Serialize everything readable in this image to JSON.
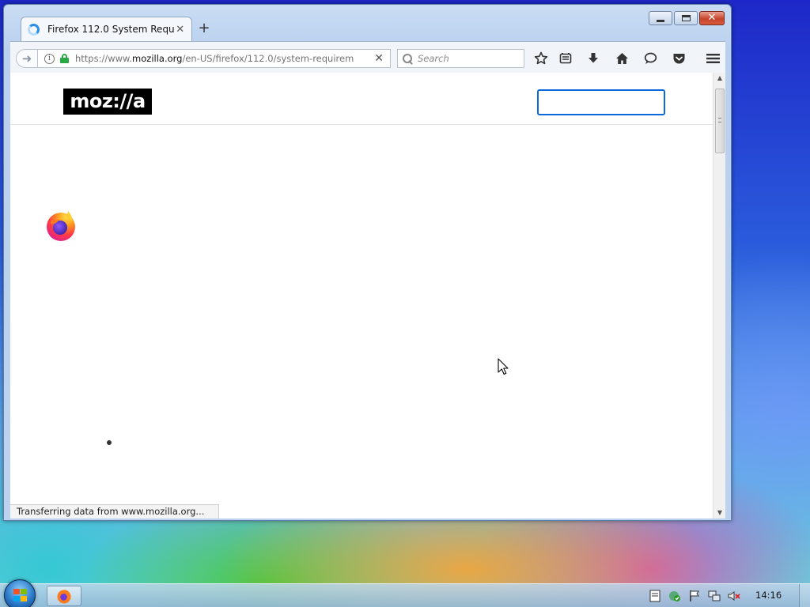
{
  "browser": {
    "tab": {
      "title": "Firefox 112.0 System Requir..."
    },
    "url": {
      "prefix": "https://www.",
      "host": "mozilla.org",
      "path": "/en-US/firefox/112.0/system-requirem"
    },
    "search": {
      "placeholder": "Search"
    },
    "status_text": "Transferring data from www.mozilla.org..."
  },
  "page": {
    "logo_text": "moz://a",
    "search_value": ""
  },
  "taskbar": {
    "clock": "14:16"
  },
  "colors": {
    "logo_bg": "#000000",
    "header_search_border": "#0a68d8",
    "secure_lock": "#2aa845",
    "close_button": "#c7432b"
  },
  "icons": {
    "tab": "loading-spinner-icon",
    "toolbar": [
      "bookmark-star-icon",
      "reading-list-icon",
      "downloads-icon",
      "home-icon",
      "chat-icon",
      "pocket-icon",
      "menu-icon"
    ],
    "tray": [
      "action-center-icon",
      "security-icon",
      "flag-icon",
      "network-icon",
      "volume-muted-icon"
    ]
  }
}
